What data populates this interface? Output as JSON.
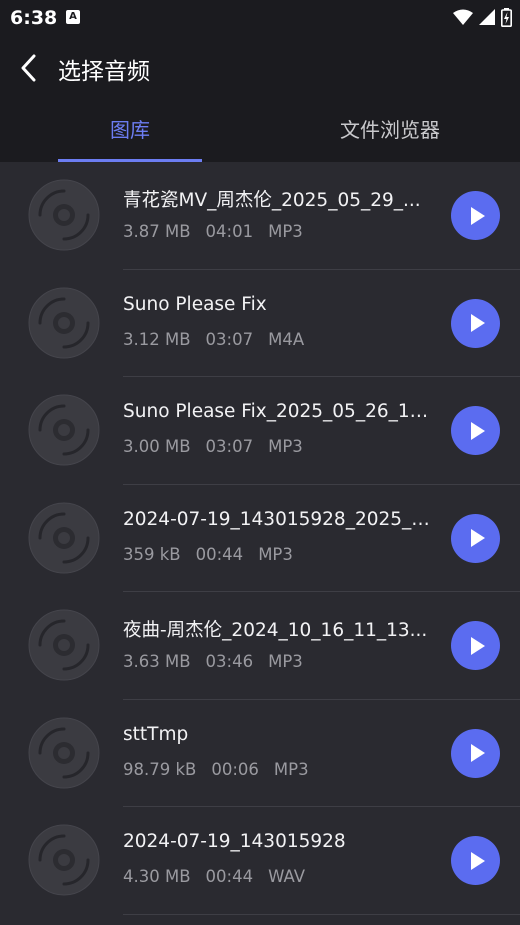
{
  "status_bar": {
    "time": "6:38",
    "notification_icon": "A"
  },
  "header": {
    "title": "选择音频",
    "back_icon": "chevron-left-icon"
  },
  "tabs": [
    {
      "label": "图库",
      "active": true
    },
    {
      "label": "文件浏览器",
      "active": false
    }
  ],
  "files": [
    {
      "title": "青花瓷MV_周杰伦_2025_05_29_...",
      "size": "3.87 MB",
      "duration": "04:01",
      "format": "MP3"
    },
    {
      "title": "Suno Please Fix",
      "size": "3.12 MB",
      "duration": "03:07",
      "format": "M4A"
    },
    {
      "title": "Suno Please Fix_2025_05_26_19...",
      "size": "3.00 MB",
      "duration": "03:07",
      "format": "MP3"
    },
    {
      "title": "2024-07-19_143015928_2025_0...",
      "size": "359 kB",
      "duration": "00:44",
      "format": "MP3"
    },
    {
      "title": "夜曲-周杰伦_2024_10_16_11_13...",
      "size": "3.63 MB",
      "duration": "03:46",
      "format": "MP3"
    },
    {
      "title": "sttTmp",
      "size": "98.79 kB",
      "duration": "00:06",
      "format": "MP3"
    },
    {
      "title": "2024-07-19_143015928",
      "size": "4.30 MB",
      "duration": "00:44",
      "format": "WAV"
    }
  ],
  "colors": {
    "accent": "#5b6cf0",
    "tab_active": "#6c7df2",
    "background": "#1b1b1f",
    "list_background": "#2a2a30"
  }
}
